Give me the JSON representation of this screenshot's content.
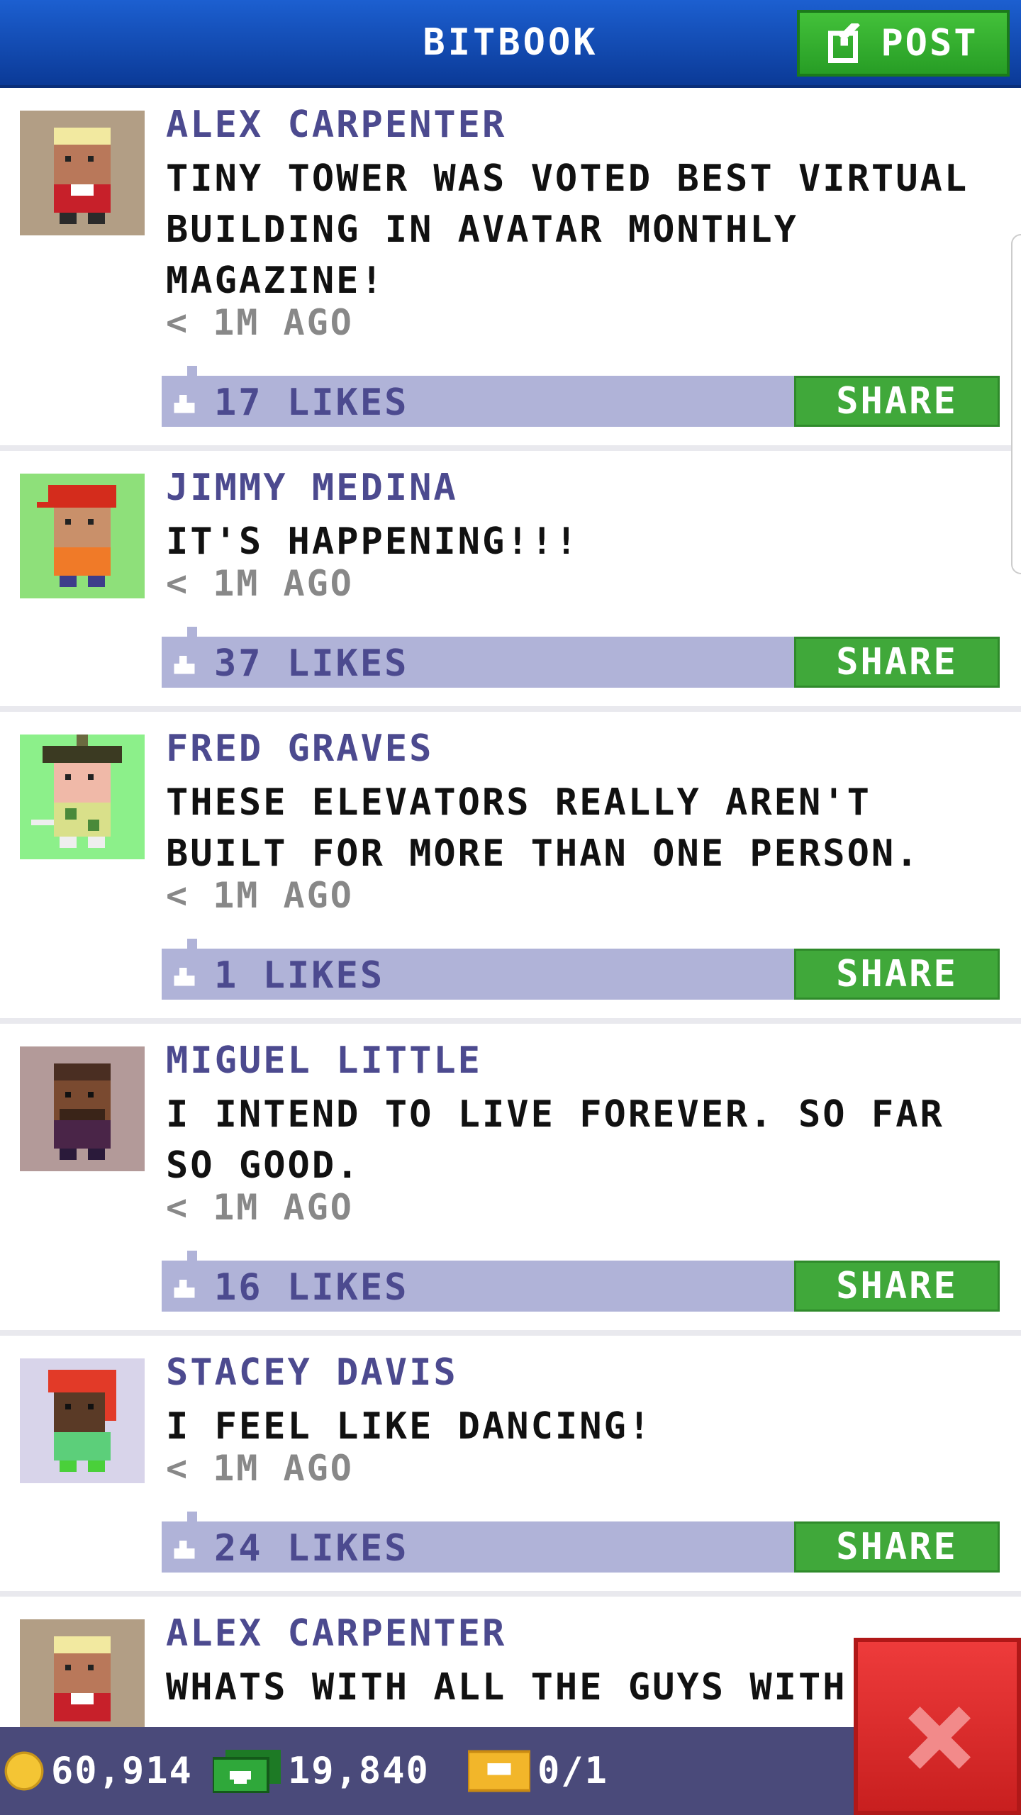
{
  "header": {
    "title": "BITBOOK",
    "post_label": "POST"
  },
  "posts": [
    {
      "author": "ALEX CARPENTER",
      "message": "TINY TOWER WAS VOTED BEST VIRTUAL BUILDING IN AVATAR MONTHLY MAGAZINE!",
      "time": "< 1M AGO",
      "likes": "17 LIKES",
      "share_label": "SHARE",
      "avatar_bg": "#b29e85"
    },
    {
      "author": "JIMMY MEDINA",
      "message": "IT'S HAPPENING!!!",
      "time": "< 1M AGO",
      "likes": "37 LIKES",
      "share_label": "SHARE",
      "avatar_bg": "#8ee07a"
    },
    {
      "author": "FRED GRAVES",
      "message": "THESE ELEVATORS REALLY AREN'T BUILT FOR MORE THAN ONE PERSON.",
      "time": "< 1M AGO",
      "likes": "1 LIKES",
      "share_label": "SHARE",
      "avatar_bg": "#8cf08a"
    },
    {
      "author": "MIGUEL LITTLE",
      "message": "I INTEND TO LIVE FOREVER. SO FAR SO GOOD.",
      "time": "< 1M AGO",
      "likes": "16 LIKES",
      "share_label": "SHARE",
      "avatar_bg": "#b39a99"
    },
    {
      "author": "STACEY DAVIS",
      "message": "I FEEL LIKE DANCING!",
      "time": "< 1M AGO",
      "likes": "24 LIKES",
      "share_label": "SHARE",
      "avatar_bg": "#d8d4ea"
    },
    {
      "author": "ALEX CARPENTER",
      "message": "WHATS WITH ALL THE GUYS WITH",
      "avatar_bg": "#b29e85"
    }
  ],
  "status": {
    "coins": "60,914",
    "bux": "19,840",
    "tickets": "0/1"
  },
  "colors": {
    "header_blue": "#1c5fd0",
    "share_green": "#40a83a",
    "likes_bar": "#b0b3d8",
    "name_purple": "#4c4a8f",
    "close_red": "#e02b2b"
  },
  "icons": {
    "post": "edit-icon",
    "like": "like-icon",
    "coin": "coin-icon",
    "bux": "bux-icon",
    "ticket": "ticket-icon",
    "close": "close-icon"
  }
}
